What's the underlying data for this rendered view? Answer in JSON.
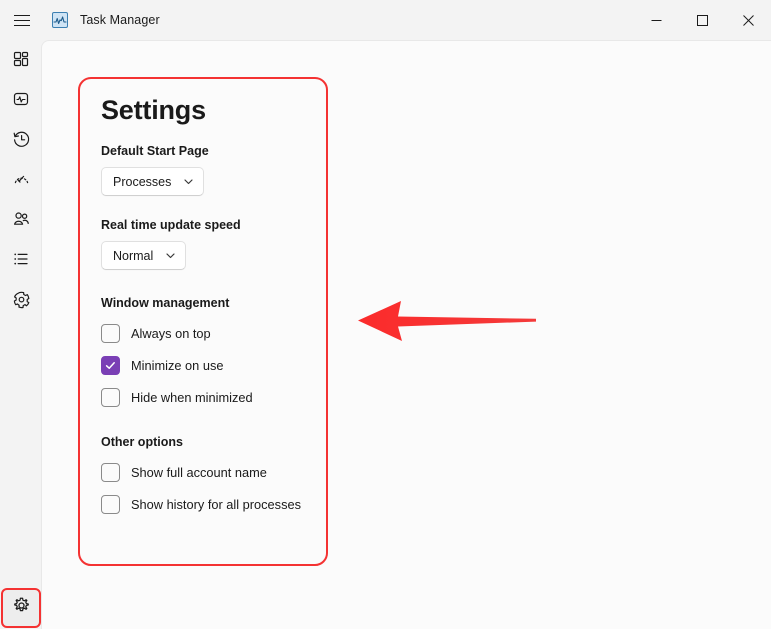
{
  "window": {
    "title": "Task Manager",
    "app_icon": "task-manager-chart-icon",
    "menu_icon": "hamburger-menu-icon",
    "controls": [
      {
        "name": "minimize",
        "glyph": "─"
      },
      {
        "name": "maximize",
        "glyph": "□"
      },
      {
        "name": "close",
        "glyph": "✕"
      }
    ]
  },
  "sidebar": {
    "items": [
      {
        "name": "processes",
        "icon": "grid-icon"
      },
      {
        "name": "performance",
        "icon": "pulse-monitor-icon"
      },
      {
        "name": "app-history",
        "icon": "clock-history-icon"
      },
      {
        "name": "startup-apps",
        "icon": "gauge-rocket-icon"
      },
      {
        "name": "users",
        "icon": "people-icon"
      },
      {
        "name": "details",
        "icon": "list-icon"
      },
      {
        "name": "services",
        "icon": "gear-cog-icon"
      }
    ],
    "settings": {
      "name": "settings",
      "icon": "gear-icon"
    }
  },
  "settings": {
    "title": "Settings",
    "default_start_page": {
      "label": "Default Start Page",
      "value": "Processes",
      "chevron": "chevron-down-icon"
    },
    "update_speed": {
      "label": "Real time update speed",
      "value": "Normal",
      "chevron": "chevron-down-icon"
    },
    "window_management": {
      "label": "Window management",
      "options": [
        {
          "label": "Always on top",
          "checked": false
        },
        {
          "label": "Minimize on use",
          "checked": true
        },
        {
          "label": "Hide when minimized",
          "checked": false
        }
      ]
    },
    "other_options": {
      "label": "Other options",
      "options": [
        {
          "label": "Show full account name",
          "checked": false
        },
        {
          "label": "Show history for all processes",
          "checked": false
        }
      ]
    }
  },
  "annotations": {
    "arrow": {
      "name": "pointer-arrow",
      "direction": "left",
      "color": "#f43232"
    },
    "panel_highlight": {
      "name": "settings-panel-highlight",
      "color": "#f43232"
    },
    "rail_highlight": {
      "name": "settings-button-highlight",
      "color": "#f43232"
    }
  },
  "colors": {
    "accent": "#7a3fb5",
    "annotation": "#f43232",
    "chrome": "#f3f3f3",
    "surface": "#fbfbfb"
  }
}
